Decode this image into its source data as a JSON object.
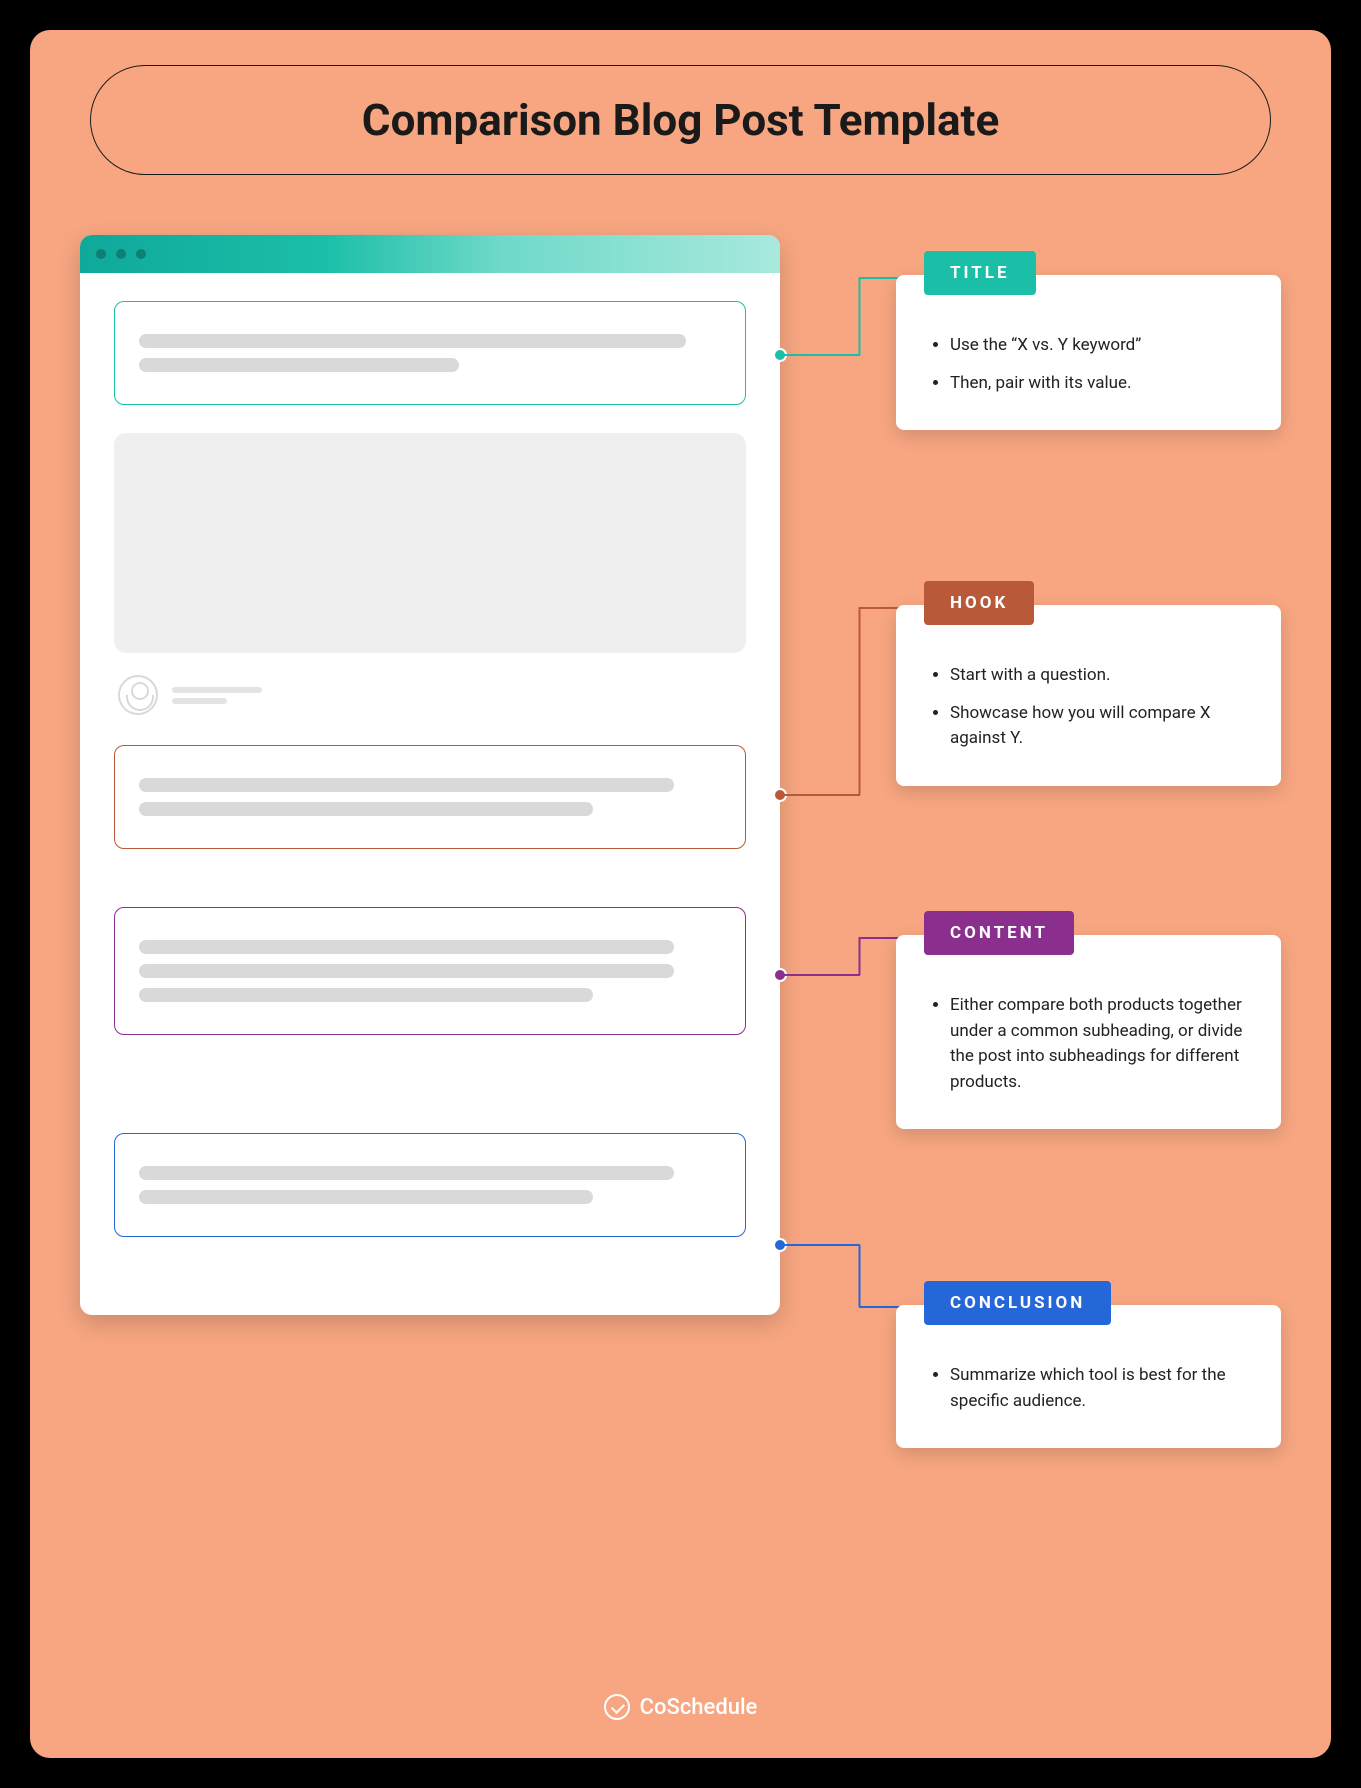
{
  "title": "Comparison Blog Post Template",
  "sections": [
    {
      "key": "title",
      "label": "TITLE",
      "color": "#1bbfa8",
      "bullets": [
        "Use the “X vs. Y keyword”",
        "Then, pair with its value."
      ]
    },
    {
      "key": "hook",
      "label": "HOOK",
      "color": "#b85a3a",
      "bullets": [
        "Start with a question.",
        "Showcase how you will compare X against Y."
      ]
    },
    {
      "key": "content",
      "label": "CONTENT",
      "color": "#8a2f8e",
      "bullets": [
        "Either compare both products together under a common subheading, or divide the post into subheadings for different products."
      ]
    },
    {
      "key": "conclusion",
      "label": "CONCLUSION",
      "color": "#2567d8",
      "bullets": [
        "Summarize which tool is best for the specific audience."
      ]
    }
  ],
  "footer": {
    "brand": "CoSchedule"
  }
}
